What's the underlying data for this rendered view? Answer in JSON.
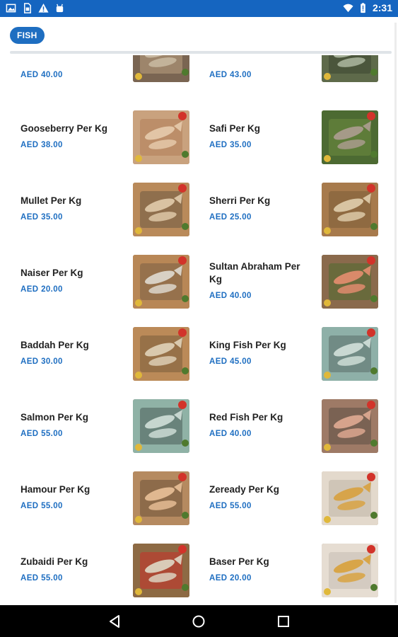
{
  "status_bar": {
    "time": "2:31",
    "left_icons": [
      "image-icon",
      "sim-card-icon",
      "warning-icon",
      "android-icon"
    ],
    "right_icons": [
      "wifi-icon",
      "battery-icon"
    ]
  },
  "category_chip": {
    "label": "FISH"
  },
  "products": [
    {
      "left": {
        "name": "",
        "price": "AED 40.00",
        "colors": [
          "#7a6552",
          "#c8b8a0",
          "#b9a07f"
        ]
      },
      "right": {
        "name": "",
        "price": "AED 43.00",
        "colors": [
          "#5e6a4a",
          "#a7b29a",
          "#3c4631"
        ]
      }
    },
    {
      "left": {
        "name": "Gooseberry Per Kg",
        "price": "AED 38.00",
        "colors": [
          "#c9a27e",
          "#e2c5a6",
          "#b07d58"
        ]
      },
      "right": {
        "name": "Safi Per Kg",
        "price": "AED 35.00",
        "colors": [
          "#4c6a32",
          "#a59a88",
          "#6e8a40"
        ]
      }
    },
    {
      "left": {
        "name": "Mullet Per Kg",
        "price": "AED 35.00",
        "colors": [
          "#b98a5a",
          "#d9c2a2",
          "#6d5a44"
        ]
      },
      "right": {
        "name": "Sherri Per Kg",
        "price": "AED 25.00",
        "colors": [
          "#a77a4c",
          "#d8c4a2",
          "#7b5c38"
        ]
      }
    },
    {
      "left": {
        "name": "Naiser Per Kg",
        "price": "AED 20.00",
        "colors": [
          "#b88756",
          "#d8d0c4",
          "#7a5f45"
        ]
      },
      "right": {
        "name": "Sultan Abraham Per Kg",
        "price": "AED 40.00",
        "colors": [
          "#8a6a4c",
          "#d98a6a",
          "#4f6a30"
        ]
      }
    },
    {
      "left": {
        "name": "Baddah Per Kg",
        "price": "AED 30.00",
        "colors": [
          "#bb8a58",
          "#d9c9ae",
          "#7a5c3c"
        ]
      },
      "right": {
        "name": "King Fish Per Kg",
        "price": "AED 45.00",
        "colors": [
          "#8eb0a8",
          "#c9d8d2",
          "#5a6e68"
        ]
      }
    },
    {
      "left": {
        "name": "Salmon Per Kg",
        "price": "AED 55.00",
        "colors": [
          "#8fb2a6",
          "#c6d6cf",
          "#4b5c57"
        ]
      },
      "right": {
        "name": "Red Fish Per Kg",
        "price": "AED 40.00",
        "colors": [
          "#9e7a66",
          "#d6a38c",
          "#5d4e44"
        ]
      }
    },
    {
      "left": {
        "name": "Hamour Per Kg",
        "price": "AED 55.00",
        "colors": [
          "#b58a60",
          "#e0b890",
          "#6c5238"
        ]
      },
      "right": {
        "name": "Zeready Per Kg",
        "price": "AED 55.00",
        "colors": [
          "#e3d9cc",
          "#d7a44a",
          "#bfb4a6"
        ]
      }
    },
    {
      "left": {
        "name": "Zubaidi Per Kg",
        "price": "AED 55.00",
        "colors": [
          "#8d6a44",
          "#d9cbb8",
          "#c8302a"
        ]
      },
      "right": {
        "name": "Baser Per Kg",
        "price": "AED 20.00",
        "colors": [
          "#e6ddd2",
          "#d8a548",
          "#c4bcb2"
        ]
      }
    }
  ],
  "nav_bar": {
    "buttons": [
      "back-icon",
      "home-icon",
      "recents-icon"
    ]
  }
}
